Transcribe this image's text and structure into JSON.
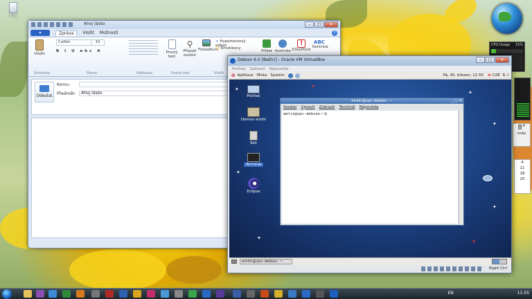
{
  "desktop": {
    "recycle_bin_label": "Koš",
    "calendar_numbers": [
      "4",
      "11",
      "18",
      "25"
    ],
    "temp": "8°",
    "weather_city": "ívsky",
    "cpu_gadget_title": "CPU Usage",
    "cpu_percent": "15%",
    "cpu_bar_level": 0.15
  },
  "mail": {
    "title": "Ahoj lásko",
    "tabs": [
      "Zpráva",
      "Vložit",
      "Možnosti"
    ],
    "ribbon": {
      "paste": "Vložit",
      "font": "Calibri",
      "size": "10",
      "plain_text": "Prostý text",
      "attach": "Připojit soubor",
      "photo_album": "Fotoalbum",
      "hyperlink": "Hypertextový odkaz",
      "emoticons": "Emotikony",
      "add": "Přidat",
      "contacts": "Kontrola",
      "priority": "Důležitost",
      "spelling": "Kontrola",
      "groups": [
        "Schránka",
        "Písmo",
        "Odstavec",
        "Prostý text",
        "Vložit"
      ]
    },
    "send": "Odeslat",
    "to_label": "Komu:",
    "subject_label": "Předmět:",
    "subject_value": "Ahoj lásko"
  },
  "vbox": {
    "title": "Debian 6.0 [Bežící] - Oracle VM VirtualBox",
    "menu": [
      "Počítač",
      "Zařízení",
      "Nápověda"
    ],
    "gnome_menu": [
      "Aplikace",
      "Místa",
      "Systém"
    ],
    "clock": "Pá, 30. březen, 11:55",
    "user": "CZE",
    "desktop_icons": [
      "Počítač",
      "Domov emlin",
      "Koš",
      "Terminál",
      "Eclipse"
    ],
    "terminal": {
      "title": "emlin@vpc-debian: ~",
      "menu": [
        "Soubor",
        "Upravit",
        "Zobrazit",
        "Terminál",
        "Nápověda"
      ],
      "prompt": "emlin@vpc-debian:~$"
    },
    "bottom_task": "emlin@vpc-debian: ~",
    "status_right": "Right Ctrl"
  },
  "taskbar": {
    "lang": "EN",
    "time": "11:55"
  }
}
